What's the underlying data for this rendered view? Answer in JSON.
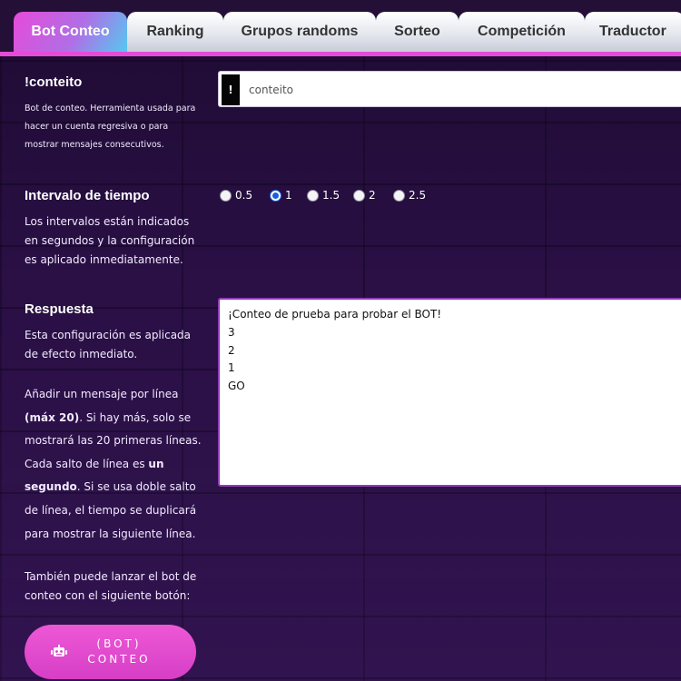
{
  "tabs": [
    {
      "label": "Bot Conteo",
      "active": true
    },
    {
      "label": "Ranking",
      "active": false
    },
    {
      "label": "Grupos randoms",
      "active": false
    },
    {
      "label": "Sorteo",
      "active": false
    },
    {
      "label": "Competición",
      "active": false
    },
    {
      "label": "Traductor",
      "active": false
    }
  ],
  "command": {
    "title": "!conteito",
    "description": "Bot de conteo. Herramienta usada para hacer un cuenta regresiva o para mostrar mensajes consecutivos.",
    "prefix": "!",
    "value": "conteito"
  },
  "interval": {
    "title": "Intervalo de tiempo",
    "description": "Los intervalos están indicados en segundos y la configuración es aplicado inmediatamente.",
    "options": [
      "0.5",
      "1",
      "1.5",
      "2",
      "2.5"
    ],
    "selected": "1"
  },
  "response": {
    "title": "Respuesta",
    "description1": "Esta configuración es aplicada de efecto inmediato.",
    "desc2_a": "Añadir un mensaje por línea ",
    "desc2_b": "(máx 20)",
    "desc2_c": ". Si hay más, solo se mostrará las 20 primeras líneas. Cada salto de línea es ",
    "desc2_d": "un segundo",
    "desc2_e": ". Si se usa doble salto de línea, el tiempo se duplicará para mostrar la siguiente línea.",
    "description3": "También puede lanzar el bot de conteo con el siguiente botón:",
    "text": "¡Conteo de prueba para probar el BOT!\n3\n2\n1\nGO"
  },
  "bot_button": {
    "label_line1": "(BOT)",
    "label_line2": "CONTEO",
    "icon": "robot-icon"
  }
}
